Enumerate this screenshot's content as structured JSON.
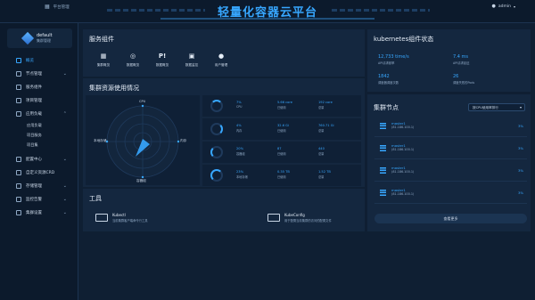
{
  "header": {
    "title": "轻量化容器云平台",
    "platform_label": "平台管理",
    "user": "admin"
  },
  "sidebar": {
    "workspace_name": "default",
    "workspace_sub": "集群管理",
    "items": [
      {
        "label": "概览",
        "active": true,
        "caret": false
      },
      {
        "label": "节点管理",
        "caret": true
      },
      {
        "label": "服务组件",
        "caret": false
      },
      {
        "label": "项目管理",
        "caret": false
      },
      {
        "label": "应用负载",
        "caret": true,
        "sub": [
          "应用负载",
          "项目服务",
          "项目集"
        ]
      },
      {
        "label": "配置中心",
        "caret": true
      },
      {
        "label": "自定义资源CRD",
        "caret": false
      },
      {
        "label": "存储管理",
        "caret": true
      },
      {
        "label": "监控告警",
        "caret": true
      },
      {
        "label": "集群设置",
        "caret": true
      }
    ]
  },
  "services": {
    "title": "服务组件",
    "items": [
      {
        "icon": "server-icon",
        "glyph": "▦",
        "label": "集群概览"
      },
      {
        "icon": "chrome-icon",
        "glyph": "◎",
        "label": "数据概览"
      },
      {
        "icon": "alert-icon",
        "glyph": "P!",
        "label": "数据概览"
      },
      {
        "icon": "image-icon",
        "glyph": "▣",
        "label": "数据监控"
      },
      {
        "icon": "user-icon",
        "glyph": "●",
        "label": "用户管理"
      }
    ]
  },
  "usage": {
    "title": "集群资源使用情况",
    "radar_labels": {
      "top": "CPU",
      "left": "本地存储",
      "right": "内存",
      "bottom": "容器组"
    },
    "rows": [
      {
        "pct": "7%",
        "pct_label": "CPU",
        "used": "5.66 core",
        "used_label": "已使用",
        "total": "192 core",
        "total_label": "总量"
      },
      {
        "pct": "4%",
        "pct_label": "内存",
        "used": "32.6 Gi",
        "used_label": "已使用",
        "total": "760.71 Gi",
        "total_label": "总量"
      },
      {
        "pct": "20%",
        "pct_label": "容器组",
        "used": "87",
        "used_label": "已使用",
        "total": "440",
        "total_label": "总量"
      },
      {
        "pct": "23%",
        "pct_label": "本地存储",
        "used": "0.35 TB",
        "used_label": "已使用",
        "total": "1.52 TB",
        "total_label": "总量"
      }
    ],
    "colors": {
      "accent": "#37a7ff"
    }
  },
  "tools": {
    "title": "工具",
    "items": [
      {
        "name": "Kubectl",
        "desc": "当前集群客户端命令行工具"
      },
      {
        "name": "KubeConfig",
        "desc": "用于配置当前集群的访问的配置文件"
      }
    ]
  },
  "k8s": {
    "title": "kubernetes组件状态",
    "cells": [
      {
        "value": "12,733 time/s",
        "label": "API请求频率"
      },
      {
        "value": "7.4 ms",
        "label": "API请求延迟"
      },
      {
        "value": "1842",
        "label": "调度器调度次数"
      },
      {
        "value": "26",
        "label": "调度失败的Pods"
      }
    ]
  },
  "nodes": {
    "title": "集群节点",
    "sort_selected": "按CPU使用率排行",
    "items": [
      {
        "name": "master1",
        "ip": "(81.186.100.1)",
        "pct": "3%"
      },
      {
        "name": "master1",
        "ip": "(81.186.100.1)",
        "pct": "3%"
      },
      {
        "name": "master1",
        "ip": "(81.186.100.1)",
        "pct": "3%"
      },
      {
        "name": "master1",
        "ip": "(81.186.100.1)",
        "pct": "3%"
      }
    ],
    "more_label": "查看更多"
  }
}
